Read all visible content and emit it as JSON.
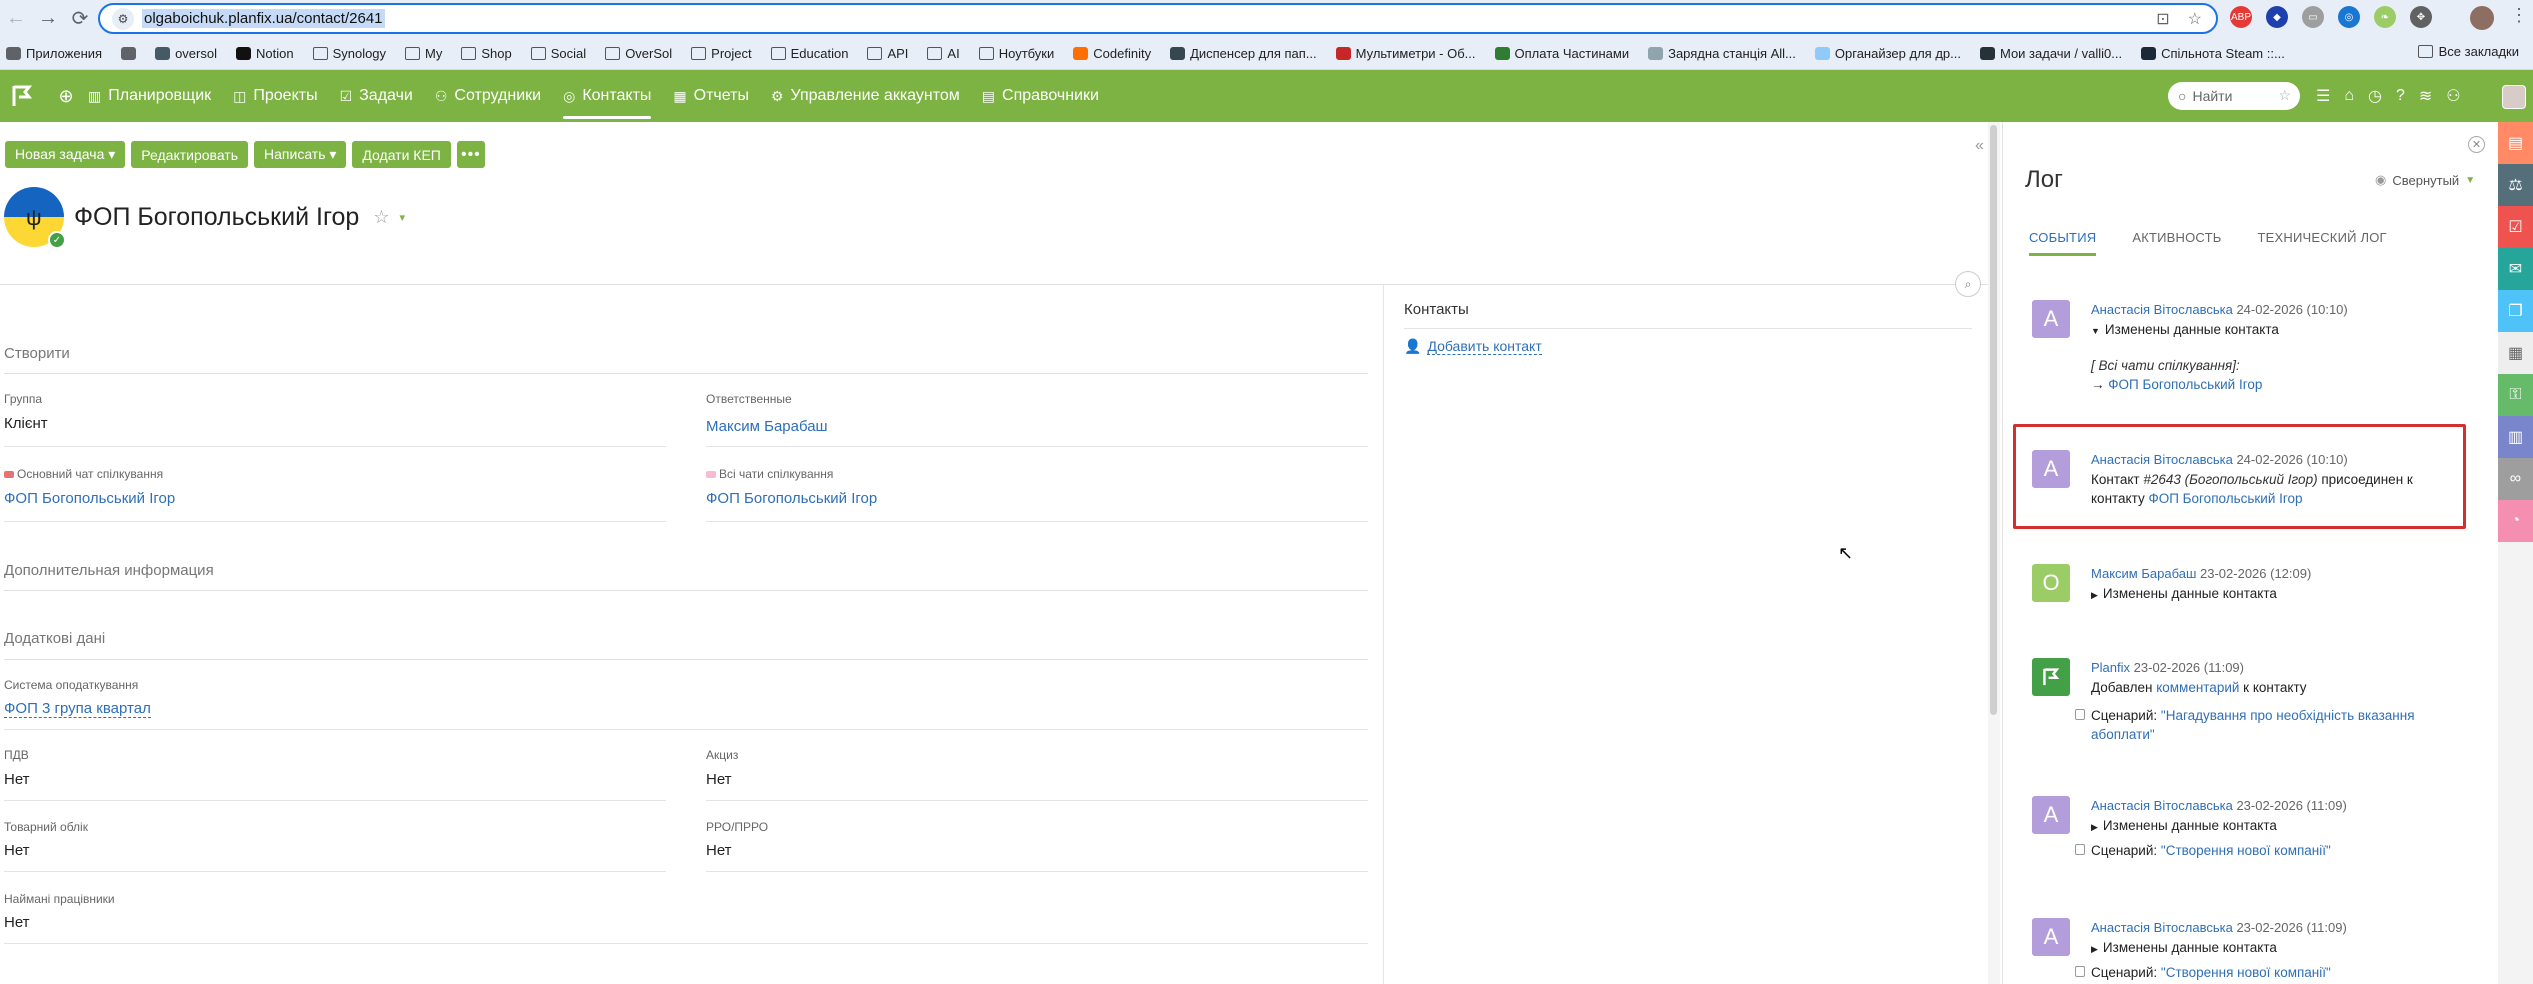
{
  "browser": {
    "url": "olgaboichuk.planfix.ua/contact/2641",
    "bookmarks": [
      {
        "label": "Приложения",
        "icon": "apps-icon"
      },
      {
        "label": "",
        "icon": "grid-icon"
      },
      {
        "label": "oversol",
        "icon": "favicon"
      },
      {
        "label": "Notion",
        "icon": "notion-icon"
      },
      {
        "label": "Synology",
        "icon": "folder-icon"
      },
      {
        "label": "My",
        "icon": "folder-icon"
      },
      {
        "label": "Shop",
        "icon": "folder-icon"
      },
      {
        "label": "Social",
        "icon": "folder-icon"
      },
      {
        "label": "OverSol",
        "icon": "folder-icon"
      },
      {
        "label": "Project",
        "icon": "folder-icon"
      },
      {
        "label": "Education",
        "icon": "folder-icon"
      },
      {
        "label": "API",
        "icon": "folder-icon"
      },
      {
        "label": "AI",
        "icon": "folder-icon"
      },
      {
        "label": "Ноутбуки",
        "icon": "folder-icon"
      },
      {
        "label": "Codefinity",
        "icon": "favicon"
      },
      {
        "label": "Диспенсер для пап...",
        "icon": "favicon"
      },
      {
        "label": "Мультиметри - Об...",
        "icon": "favicon"
      },
      {
        "label": "Оплата Частинами",
        "icon": "favicon"
      },
      {
        "label": "Зарядна станція All...",
        "icon": "favicon"
      },
      {
        "label": "Органайзер для др...",
        "icon": "favicon"
      },
      {
        "label": "Мои задачи / valli0...",
        "icon": "favicon"
      },
      {
        "label": "Спільнота Steam ::...",
        "icon": "favicon"
      }
    ],
    "bookmarks_right": "Все закладки"
  },
  "app": {
    "menu": [
      {
        "label": "Планировщик",
        "icon": "planner-icon"
      },
      {
        "label": "Проекты",
        "icon": "projects-icon"
      },
      {
        "label": "Задачи",
        "icon": "tasks-icon"
      },
      {
        "label": "Сотрудники",
        "icon": "employees-icon"
      },
      {
        "label": "Контакты",
        "icon": "contacts-icon",
        "active": true
      },
      {
        "label": "Отчеты",
        "icon": "reports-icon"
      },
      {
        "label": "Управление аккаунтом",
        "icon": "account-icon"
      },
      {
        "label": "Справочники",
        "icon": "directories-icon"
      }
    ],
    "search_placeholder": "Найти"
  },
  "toolbar": {
    "new_task": "Новая задача ▾",
    "edit": "Редактировать",
    "write": "Написать ▾",
    "add_kep": "Додати КЕП",
    "more": "•••"
  },
  "contact": {
    "name": "ФОП Богопольський Ігор"
  },
  "fields": {
    "section_create": "Створити",
    "group_label": "Группа",
    "group_value": "Клієнт",
    "responsible_label": "Ответственные",
    "responsible_value": "Максим Барабаш",
    "main_chat_label": "Основний чат спілкування",
    "main_chat_value": "ФОП Богопольський Ігор",
    "all_chats_label": "Всі чати спілкування",
    "all_chats_value": "ФОП Богопольський Ігор",
    "section_additional": "Дополнительная информация",
    "section_extra": "Додаткові дані",
    "tax_label": "Система оподаткування",
    "tax_value": "ФОП 3 група квартал",
    "vat_label": "ПДВ",
    "vat_value": "Нет",
    "excise_label": "Акциз",
    "excise_value": "Нет",
    "goods_label": "Товарний облік",
    "goods_value": "Нет",
    "rro_label": "РРО/ПРРО",
    "rro_value": "Нет",
    "employees_label": "Наймані працівники",
    "employees_value": "Нет"
  },
  "contacts_block": {
    "title": "Контакты",
    "add": "Добавить контакт"
  },
  "log": {
    "title": "Лог",
    "view_mode": "Свернутый",
    "tabs": [
      "СОБЫТИЯ",
      "АКТИВНОСТЬ",
      "ТЕХНИЧЕСКИЙ ЛОГ"
    ],
    "entries": [
      {
        "avatar": "A",
        "author": "Анастасія Вітославська",
        "date": "24-02-2026 (10:10)",
        "line1": "Изменены данные контакта",
        "line2": "[ Всі чати спілкування]:",
        "line3_prefix": "→ ",
        "line3_link": "ФОП Богопольський Ігор"
      },
      {
        "avatar": "A",
        "author": "Анастасія Вітославська",
        "date": "24-02-2026 (10:10)",
        "text_prefix": "Контакт ",
        "text_italic": "#2643 (Богопольський Ігор)",
        "text_mid": " присоединен к контакту ",
        "text_link": "ФОП Богопольський Ігор"
      },
      {
        "avatar": "О",
        "author": "Максим Барабаш",
        "date": "23-02-2026 (12:09)",
        "line1": "Изменены данные контакта"
      },
      {
        "avatar": "",
        "author": "Planfix",
        "date": "23-02-2026 (11:09)",
        "text_prefix": "Добавлен ",
        "text_link": "комментарий",
        "text_suffix": " к контакту",
        "script_label": "Сценарий: ",
        "script_value": "\"Нагадування про необхідність вказання абоплати\""
      },
      {
        "avatar": "A",
        "author": "Анастасія Вітославська",
        "date": "23-02-2026 (11:09)",
        "line1": "Изменены данные контакта",
        "script_label": "Сценарий: ",
        "script_value": "\"Створення нової компанії\""
      },
      {
        "avatar": "A",
        "author": "Анастасія Вітославська",
        "date": "23-02-2026 (11:09)",
        "line1": "Изменены данные контакта",
        "script_label": "Сценарий: ",
        "script_value": "\"Створення нової компанії\""
      }
    ]
  },
  "colors": {
    "brand_green": "#7cb342",
    "link_blue": "#2f6fb7",
    "highlight_red": "#d32f2f",
    "avatar_purple": "#b39ddb",
    "avatar_green": "#9ccc65"
  }
}
